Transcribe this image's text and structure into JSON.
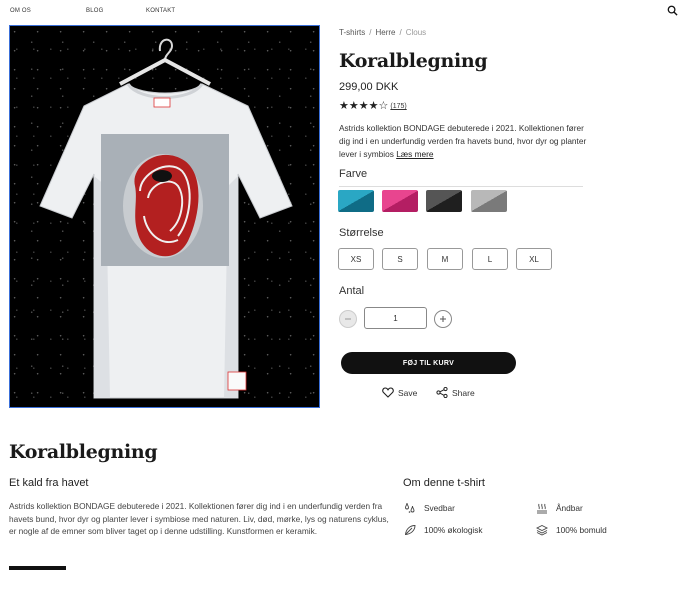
{
  "nav": {
    "items": [
      "OM OS",
      "BLOG",
      "KONTAKT"
    ]
  },
  "breadcrumb": {
    "items": [
      "T-shirts",
      "Herre",
      "Clous"
    ]
  },
  "product": {
    "title": "Koralblegning",
    "price": "299,00 DKK",
    "rating": 4,
    "rating_max": 5,
    "review_count": "(175)",
    "description": "Astrids kollektion BONDAGE debuterede i 2021. Kollektionen fører dig ind i en underfundig verden fra havets bund, hvor dyr og planter lever i symbios",
    "read_more": "Læs mere",
    "image_tag": "mrm"
  },
  "color": {
    "label": "Farve",
    "swatches": [
      {
        "light": "#2aa7c4",
        "dark": "#0f6c86"
      },
      {
        "light": "#e8458f",
        "dark": "#b41e63"
      },
      {
        "light": "#555555",
        "dark": "#1f1f1f"
      },
      {
        "light": "#b8b8b8",
        "dark": "#7a7a7a"
      }
    ]
  },
  "size": {
    "label": "Størrelse",
    "options": [
      "XS",
      "S",
      "M",
      "L",
      "XL"
    ]
  },
  "quantity": {
    "label": "Antal",
    "value": "1"
  },
  "actions": {
    "add_to_cart": "FØJ TIL KURV",
    "save": "Save",
    "share": "Share"
  },
  "details": {
    "title": "Koralblegning",
    "subtitle": "Et kald fra havet",
    "description": "Astrids kollektion BONDAGE debuterede i 2021. Kollektionen fører dig ind i en underfundig verden fra havets bund, hvor dyr og planter lever i symbiose med naturen. Liv, død, mørke, lys og naturens cyklus, er nogle af de emner som bliver taget op i denne udstilling. Kunstformen er keramik."
  },
  "about": {
    "title": "Om denne t-shirt",
    "features": [
      {
        "icon": "sweat-icon",
        "label": "Svedbar"
      },
      {
        "icon": "breathable-icon",
        "label": "Åndbar"
      },
      {
        "icon": "leaf-icon",
        "label": "100% økologisk"
      },
      {
        "icon": "fabric-icon",
        "label": "100% bomuld"
      }
    ]
  }
}
